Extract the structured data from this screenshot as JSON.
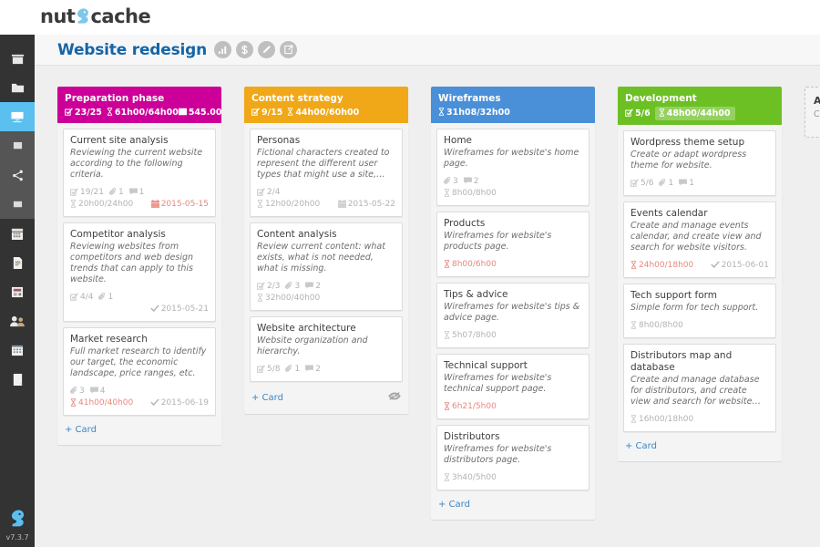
{
  "app": {
    "logo_text_pre": "nut",
    "logo_text_post": "cache",
    "version": "v7.3.7"
  },
  "colors": {
    "accent_blue": "#1565a8",
    "list_preparation": "#cc0099",
    "list_content": "#f0a818",
    "list_wireframes": "#4a90d9",
    "list_development": "#6cc024",
    "sidebar_dark": "#333333",
    "sidebar_mid": "#555555",
    "sidebar_active": "#5bbff0",
    "overdue_red": "#e8887f",
    "muted": "#b3b3b3"
  },
  "sidebar": {
    "items": [
      {
        "name": "dashboard",
        "icon": "store-icon",
        "active": false,
        "group": "a"
      },
      {
        "name": "projects",
        "icon": "folder-icon",
        "active": false,
        "group": "a"
      },
      {
        "name": "boards",
        "icon": "board-icon",
        "active": true,
        "group": "b"
      },
      {
        "name": "tasks",
        "icon": "task-icon",
        "active": false,
        "group": "b"
      },
      {
        "name": "share",
        "icon": "share-icon",
        "active": false,
        "group": "b"
      },
      {
        "name": "cards",
        "icon": "card-icon",
        "active": false,
        "group": "b"
      },
      {
        "name": "calendar",
        "icon": "calendar-icon",
        "active": false,
        "group": "a"
      },
      {
        "name": "reports",
        "icon": "document-icon",
        "active": false,
        "group": "a"
      },
      {
        "name": "invoices",
        "icon": "invoice-icon",
        "active": false,
        "group": "a"
      },
      {
        "name": "contacts",
        "icon": "people-icon",
        "active": false,
        "group": "a"
      },
      {
        "name": "timesheet",
        "icon": "grid-icon",
        "active": false,
        "group": "a"
      },
      {
        "name": "notes",
        "icon": "note-icon",
        "active": false,
        "group": "a"
      }
    ]
  },
  "header": {
    "title": "Website redesign",
    "icons": [
      {
        "name": "chart-icon",
        "glyph": "chart"
      },
      {
        "name": "dollar-icon",
        "glyph": "dollar"
      },
      {
        "name": "pencil-icon",
        "glyph": "pencil"
      },
      {
        "name": "export-icon",
        "glyph": "export"
      }
    ]
  },
  "add_list": {
    "title": "Add list",
    "subtitle": "Create a new list"
  },
  "lists": [
    {
      "name": "preparation-phase",
      "title": "Preparation phase",
      "color": "#cc0099",
      "tasks": "23/25",
      "time": "61h00/64h00",
      "time_highlight": false,
      "time_over": false,
      "money": "545.00",
      "add_card": "+ Card",
      "watch_icon": false,
      "cards": [
        {
          "title": "Current site analysis",
          "desc": "Reviewing the current website according to the following criteria.",
          "tasks": "19/21",
          "attachments": "1",
          "comments": "1",
          "time": "20h00/24h00",
          "time_over": false,
          "date": "2015-05-15",
          "date_type": "due"
        },
        {
          "title": "Competitor analysis",
          "desc": "Reviewing websites from competitors and web design trends that can apply to this website.",
          "tasks": "4/4",
          "attachments": "1",
          "comments": "",
          "time": "",
          "time_over": false,
          "date": "2015-05-21",
          "date_type": "done"
        },
        {
          "title": "Market research",
          "desc": "Full market research to identify our target, the economic landscape, price ranges, etc.",
          "tasks": "",
          "attachments": "3",
          "comments": "4",
          "time": "41h00/40h00",
          "time_over": true,
          "date": "2015-06-19",
          "date_type": "done"
        }
      ]
    },
    {
      "name": "content-strategy",
      "title": "Content strategy",
      "color": "#f0a818",
      "tasks": "9/15",
      "time": "44h00/60h00",
      "time_highlight": false,
      "time_over": false,
      "money": "",
      "add_card": "+ Card",
      "watch_icon": true,
      "cards": [
        {
          "title": "Personas",
          "desc": "Fictional characters created to represent the different user types that might use a site,…",
          "tasks": "2/4",
          "attachments": "",
          "comments": "",
          "time": "12h00/20h00",
          "time_over": false,
          "date": "2015-05-22",
          "date_type": "due-gray"
        },
        {
          "title": "Content analysis",
          "desc": "Review current content: what exists, what is not needed, what is missing.",
          "tasks": "2/3",
          "attachments": "3",
          "comments": "2",
          "time": "32h00/40h00",
          "time_over": false,
          "date": "",
          "date_type": ""
        },
        {
          "title": "Website architecture",
          "desc": "Website organization and hierarchy.",
          "tasks": "5/8",
          "attachments": "1",
          "comments": "2",
          "time": "",
          "time_over": false,
          "date": "",
          "date_type": ""
        }
      ]
    },
    {
      "name": "wireframes",
      "title": "Wireframes",
      "color": "#4a90d9",
      "tasks": "",
      "time": "31h08/32h00",
      "time_highlight": false,
      "time_over": false,
      "money": "",
      "add_card": "+ Card",
      "watch_icon": false,
      "cards": [
        {
          "title": "Home",
          "desc": "Wireframes for website's home page.",
          "tasks": "",
          "attachments": "3",
          "comments": "2",
          "time": "8h00/8h00",
          "time_over": false,
          "date": "",
          "date_type": ""
        },
        {
          "title": "Products",
          "desc": "Wireframes for website's products page.",
          "tasks": "",
          "attachments": "",
          "comments": "",
          "time": "8h00/6h00",
          "time_over": true,
          "date": "",
          "date_type": ""
        },
        {
          "title": "Tips & advice",
          "desc": "Wireframes for website's tips & advice page.",
          "tasks": "",
          "attachments": "",
          "comments": "",
          "time": "5h07/8h00",
          "time_over": false,
          "date": "",
          "date_type": ""
        },
        {
          "title": "Technical support",
          "desc": "Wireframes for website's technical support page.",
          "tasks": "",
          "attachments": "",
          "comments": "",
          "time": "6h21/5h00",
          "time_over": true,
          "date": "",
          "date_type": ""
        },
        {
          "title": "Distributors",
          "desc": "Wireframes for website's distributors page.",
          "tasks": "",
          "attachments": "",
          "comments": "",
          "time": "3h40/5h00",
          "time_over": false,
          "date": "",
          "date_type": ""
        }
      ]
    },
    {
      "name": "development",
      "title": "Development",
      "color": "#6cc024",
      "tasks": "5/6",
      "time": "48h00/44h00",
      "time_highlight": true,
      "time_over": false,
      "money": "",
      "add_card": "+ Card",
      "watch_icon": false,
      "cards": [
        {
          "title": "Wordpress theme setup",
          "desc": "Create or adapt wordpress theme for website.",
          "tasks": "5/6",
          "attachments": "1",
          "comments": "1",
          "time": "",
          "time_over": false,
          "date": "",
          "date_type": ""
        },
        {
          "title": "Events calendar",
          "desc": "Create and manage events calendar, and create view and search for website visitors.",
          "tasks": "",
          "attachments": "",
          "comments": "",
          "time": "24h00/18h00",
          "time_over": true,
          "date": "2015-06-01",
          "date_type": "done"
        },
        {
          "title": "Tech support form",
          "desc": "Simple form for tech support.",
          "tasks": "",
          "attachments": "",
          "comments": "",
          "time": "8h00/8h00",
          "time_over": false,
          "date": "",
          "date_type": ""
        },
        {
          "title": "Distributors map and database",
          "desc": "Create and manage database for distributors, and create view and search for website…",
          "tasks": "",
          "attachments": "",
          "comments": "",
          "time": "16h00/18h00",
          "time_over": false,
          "date": "",
          "date_type": ""
        }
      ]
    }
  ]
}
